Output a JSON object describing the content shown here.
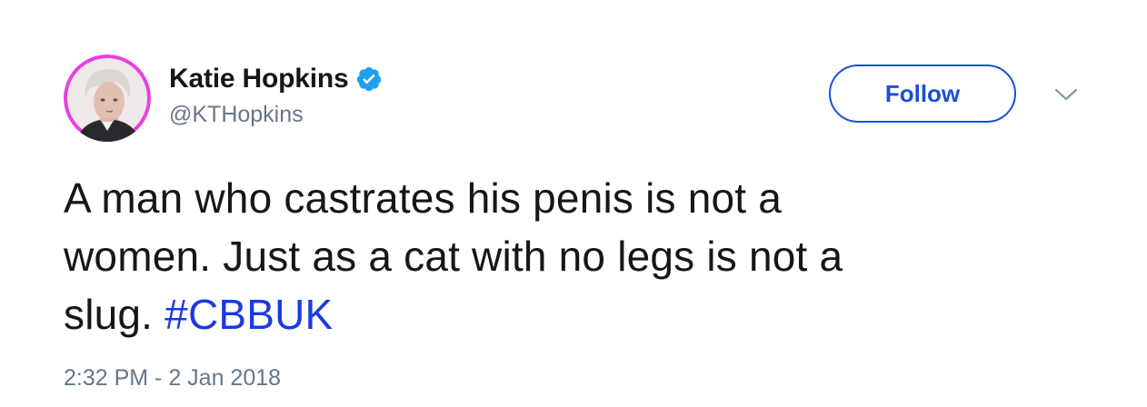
{
  "author": {
    "display_name": "Katie Hopkins",
    "handle": "@KTHopkins",
    "verified": true,
    "avatar_border_color": "#e83fe0"
  },
  "actions": {
    "follow_label": "Follow",
    "more_icon": "chevron-down-icon"
  },
  "tweet": {
    "text_line1": "A man who castrates his penis is not a",
    "text_line2": "women. Just as a cat with no legs is not a",
    "text_line3_prefix": "slug. ",
    "hashtag": "#CBBUK",
    "timestamp": "2:32 PM - 2 Jan 2018"
  },
  "colors": {
    "accent": "#1b4fd6",
    "hashtag": "#1b3ae0",
    "text": "#14171a",
    "secondary": "#657786",
    "verified_badge": "#1da1f2"
  }
}
